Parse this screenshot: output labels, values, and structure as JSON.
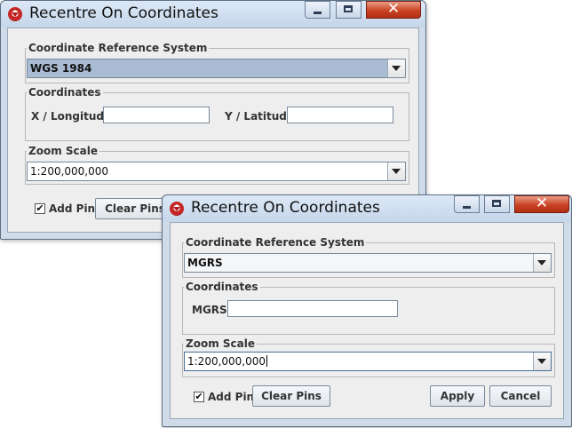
{
  "dialog_back": {
    "title": "Recentre On Coordinates",
    "crs_legend": "Coordinate Reference System",
    "crs_value": "WGS 1984",
    "coords_legend": "Coordinates",
    "x_label": "X / Longitude:",
    "y_label": "Y / Latitude:",
    "zoom_legend": "Zoom Scale",
    "zoom_value": "1:200,000,000",
    "add_pin_label": "Add Pin",
    "clear_pins_label": "Clear Pins"
  },
  "dialog_front": {
    "title": "Recentre On Coordinates",
    "crs_legend": "Coordinate Reference System",
    "crs_value": "MGRS",
    "coords_legend": "Coordinates",
    "mgrs_label": "MGRS:",
    "zoom_legend": "Zoom Scale",
    "zoom_value": "1:200,000,000",
    "add_pin_label": "Add Pin",
    "add_pin_checked": true,
    "clear_pins_label": "Clear Pins",
    "apply_label": "Apply",
    "cancel_label": "Cancel"
  },
  "icons": {
    "checkmark": "✔",
    "close": "✕"
  },
  "colors": {
    "title_bar": "#c5d6ea",
    "close_button": "#c94424",
    "selected_combo": "#a9bcd3",
    "panel_bg": "#eeeeee"
  }
}
